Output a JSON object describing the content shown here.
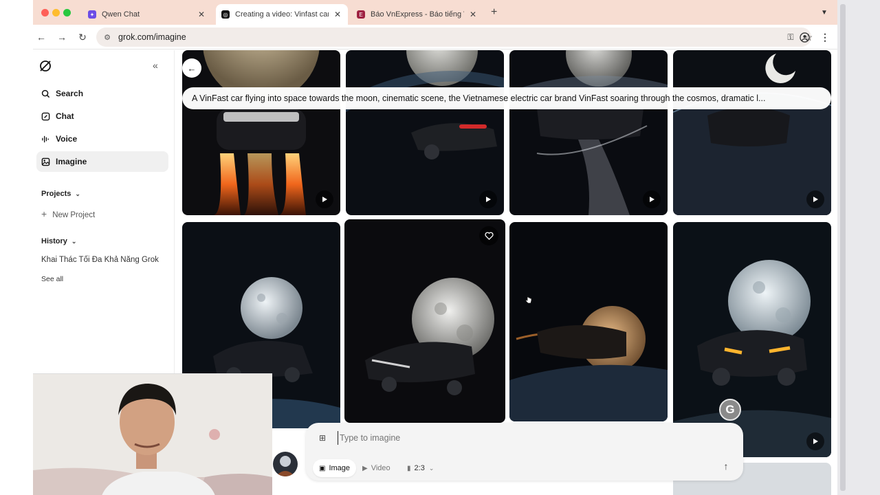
{
  "browser": {
    "tabs": [
      {
        "title": "Qwen Chat",
        "icon": "qwen-icon",
        "active": false
      },
      {
        "title": "Creating a video: Vinfast car f",
        "icon": "grok-icon",
        "active": true
      },
      {
        "title": "Báo VnExpress - Báo tiếng Vi",
        "icon": "vnexpress-icon",
        "active": false
      }
    ],
    "url": "grok.com/imagine"
  },
  "sidebar": {
    "nav": [
      {
        "label": "Search",
        "icon": "search-icon"
      },
      {
        "label": "Chat",
        "icon": "chat-icon"
      },
      {
        "label": "Voice",
        "icon": "voice-icon"
      },
      {
        "label": "Imagine",
        "icon": "imagine-icon",
        "active": true
      }
    ],
    "projects_heading": "Projects",
    "new_project": "New Project",
    "history_heading": "History",
    "history_items": [
      "Khai Thác Tối Đa Khả Năng Grok"
    ],
    "see_all": "See all"
  },
  "main": {
    "prompt": "A VinFast car flying into space towards the moon, cinematic scene, the Vietnamese electric car brand VinFast soaring through the cosmos, dramatic l...",
    "composer": {
      "placeholder": "Type to imagine",
      "modes": [
        {
          "label": "Image",
          "icon": "image-icon",
          "selected": true
        },
        {
          "label": "Video",
          "icon": "video-icon",
          "selected": false
        }
      ],
      "aspect_ratio": "2:3"
    }
  },
  "colors": {
    "tabstrip_bg": "#f7ddd2",
    "omnibox_bg": "#f2ece9",
    "active_nav_bg": "#f0f0f0",
    "composer_bg": "#f4f4f4"
  }
}
